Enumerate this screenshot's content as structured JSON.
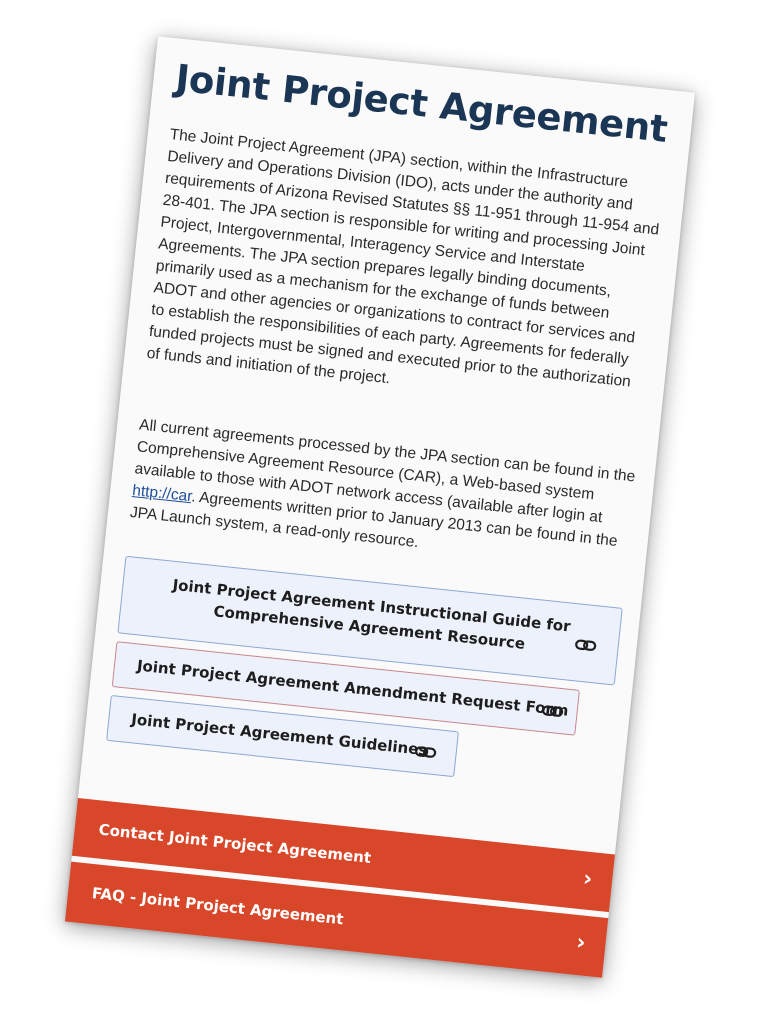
{
  "page": {
    "title": "Joint Project Agreement",
    "intro": "The Joint Project Agreement (JPA) section, within the Infrastructure Delivery and Operations Division (IDO), acts under the authority and requirements of Arizona Revised Statutes §§ 11-951 through 11-954 and 28-401. The JPA section is responsible for writing and processing Joint Project, Intergovernmental, Interagency Service and Interstate Agreements. The JPA section prepares legally binding documents, primarily used as a mechanism for the exchange of funds between ADOT and other agencies or organizations to contract for services and to establish the responsibilities of each party. Agreements for federally funded projects must be signed and executed prior to the authorization of funds and initiation of the project.",
    "current": {
      "text_before": "All current agreements processed by the JPA section can be found in the Comprehensive Agreement Resource (CAR), a Web-based system available to those with ADOT network access (available after login at ",
      "link_text": "http://car",
      "text_after": ". Agreements written prior to January 2013 can be found in the JPA Launch system, a read-only resource."
    }
  },
  "links": [
    {
      "label": "Joint Project Agreement Instructional Guide for Comprehensive Agreement Resource",
      "icon": "link-icon"
    },
    {
      "label": "Joint Project Agreement Amendment Request Form",
      "icon": "link-icon"
    },
    {
      "label": "Joint Project Agreement Guidelines",
      "icon": "link-icon"
    }
  ],
  "accordions": [
    {
      "label": "Contact Joint Project Agreement",
      "chevron": "›",
      "icon": "chevron-right-icon"
    },
    {
      "label": "FAQ - Joint Project Agreement",
      "chevron": "›",
      "icon": "chevron-right-icon"
    }
  ],
  "colors": {
    "heading": "#1b3554",
    "link_button_bg": "#ecf1fb",
    "link_button_border": "#8ea8d3",
    "accordion_bg": "#d9472b",
    "link": "#1f4f9a"
  }
}
